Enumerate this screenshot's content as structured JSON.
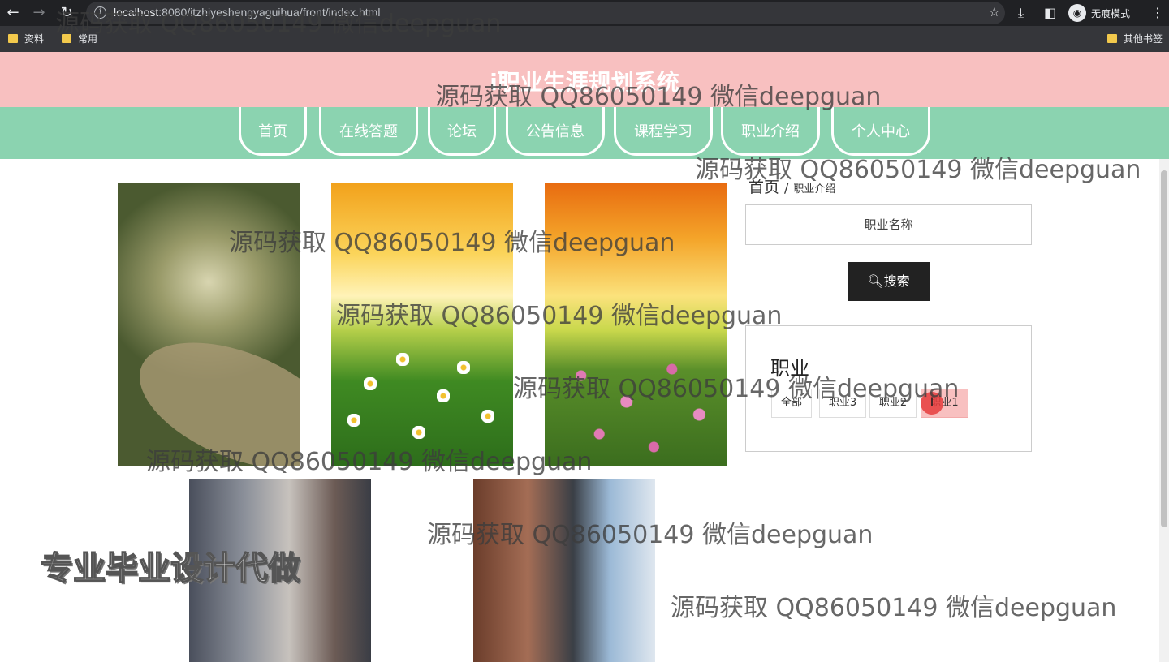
{
  "browser": {
    "url_host": "localhost",
    "url_rest": ":8080/itzhiyeshengyaguihua/front/index.html",
    "incognito_label": "无痕模式",
    "bookmarks": [
      "资料",
      "常用"
    ],
    "other_bookmarks": "其他书签"
  },
  "site": {
    "title": "i职业生涯规划系统",
    "nav": [
      "首页",
      "在线答题",
      "论坛",
      "公告信息",
      "课程学习",
      "职业介绍",
      "个人中心"
    ]
  },
  "breadcrumb": {
    "home": "首页",
    "sep": "/",
    "current": "职业介绍"
  },
  "search": {
    "placeholder": "职业名称",
    "button": "搜索"
  },
  "category": {
    "title": "职业",
    "options": [
      "全部",
      "职业3",
      "职业2",
      "职业1"
    ],
    "selected": "职业1"
  },
  "watermark": "源码获取 QQ86050149 微信deepguan",
  "promo": "专业毕业设计代做",
  "colors": {
    "header": "#f8c0c0",
    "nav": "#8bd3b0",
    "search_button": "#222222"
  }
}
